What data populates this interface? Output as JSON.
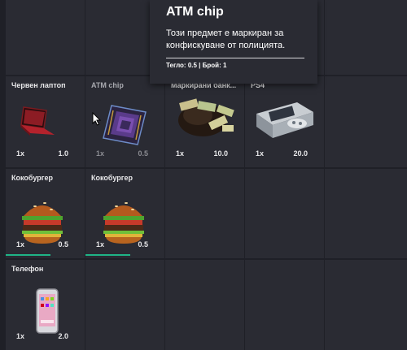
{
  "inventory": {
    "slots": [
      {
        "name": "Червен лаптоп",
        "count": "1x",
        "weight": "1.0",
        "icon": "red-laptop-icon"
      },
      {
        "name": "ATM chip",
        "count": "1x",
        "weight": "0.5",
        "icon": "atm-chip-icon",
        "dimmed": true
      },
      {
        "name": "Маркирани банк...",
        "count": "1x",
        "weight": "10.0",
        "icon": "marked-money-bag-icon"
      },
      {
        "name": "PS4",
        "count": "1x",
        "weight": "20.0",
        "icon": "ps4-console-icon"
      },
      {
        "name": "Кокобургер",
        "count": "1x",
        "weight": "0.5",
        "icon": "burger-icon",
        "durability": 0.57
      },
      {
        "name": "Кокобургер",
        "count": "1x",
        "weight": "0.5",
        "icon": "burger-icon",
        "durability": 0.57
      },
      {
        "name": "Телефон",
        "count": "1x",
        "weight": "2.0",
        "icon": "phone-icon"
      }
    ]
  },
  "tooltip": {
    "title": "ATM chip",
    "description": "Този предмет е маркиран за конфискуване от полицията.",
    "meta": "Тегло: 0.5 | Брой: 1"
  },
  "colors": {
    "background": "#1f2027",
    "slot": "#2a2b33",
    "durability_bar": "#1fb486",
    "text": "#e8e8ea"
  }
}
